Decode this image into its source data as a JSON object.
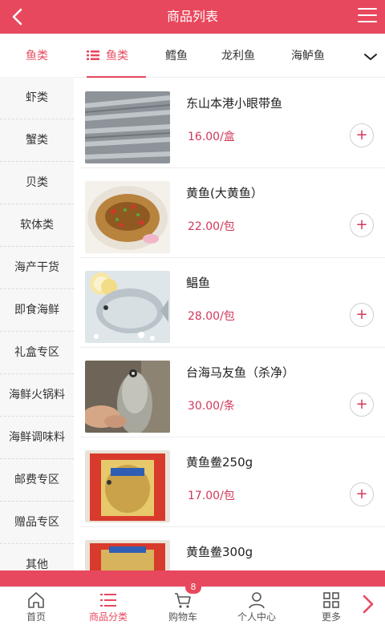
{
  "header": {
    "title": "商品列表"
  },
  "sidebar": {
    "items": [
      {
        "label": "鱼类",
        "active": true
      },
      {
        "label": "虾类"
      },
      {
        "label": "蟹类"
      },
      {
        "label": "贝类"
      },
      {
        "label": "软体类"
      },
      {
        "label": "海产干货"
      },
      {
        "label": "即食海鲜"
      },
      {
        "label": "礼盒专区"
      },
      {
        "label": "海鲜火锅料"
      },
      {
        "label": "海鲜调味料"
      },
      {
        "label": "邮费专区"
      },
      {
        "label": "赠品专区"
      },
      {
        "label": "其他"
      }
    ]
  },
  "tabs": [
    {
      "label": "鱼类",
      "active": true
    },
    {
      "label": "鳕鱼"
    },
    {
      "label": "龙利鱼"
    },
    {
      "label": "海鲈鱼"
    }
  ],
  "products": [
    {
      "name": "东山本港小眼带鱼",
      "price": "16.00/盒",
      "add": "+"
    },
    {
      "name": "黄鱼(大黄鱼）",
      "price": "22.00/包",
      "add": "+"
    },
    {
      "name": "鲳鱼",
      "price": "28.00/包",
      "add": "+"
    },
    {
      "name": "台海马友鱼（杀净）",
      "price": "30.00/条",
      "add": "+"
    },
    {
      "name": "黄鱼鲞250g",
      "price": "17.00/包",
      "add": "+"
    },
    {
      "name": "黄鱼鲞300g",
      "price": "",
      "add": ""
    }
  ],
  "nav": {
    "items": [
      {
        "label": "首页",
        "icon": "home-icon"
      },
      {
        "label": "商品分类",
        "icon": "list-icon",
        "active": true
      },
      {
        "label": "购物车",
        "icon": "cart-icon",
        "badge": "8"
      },
      {
        "label": "个人中心",
        "icon": "user-icon"
      },
      {
        "label": "更多",
        "icon": "grid-icon"
      }
    ]
  },
  "colors": {
    "accent": "#e8485e",
    "price": "#d2385a"
  }
}
